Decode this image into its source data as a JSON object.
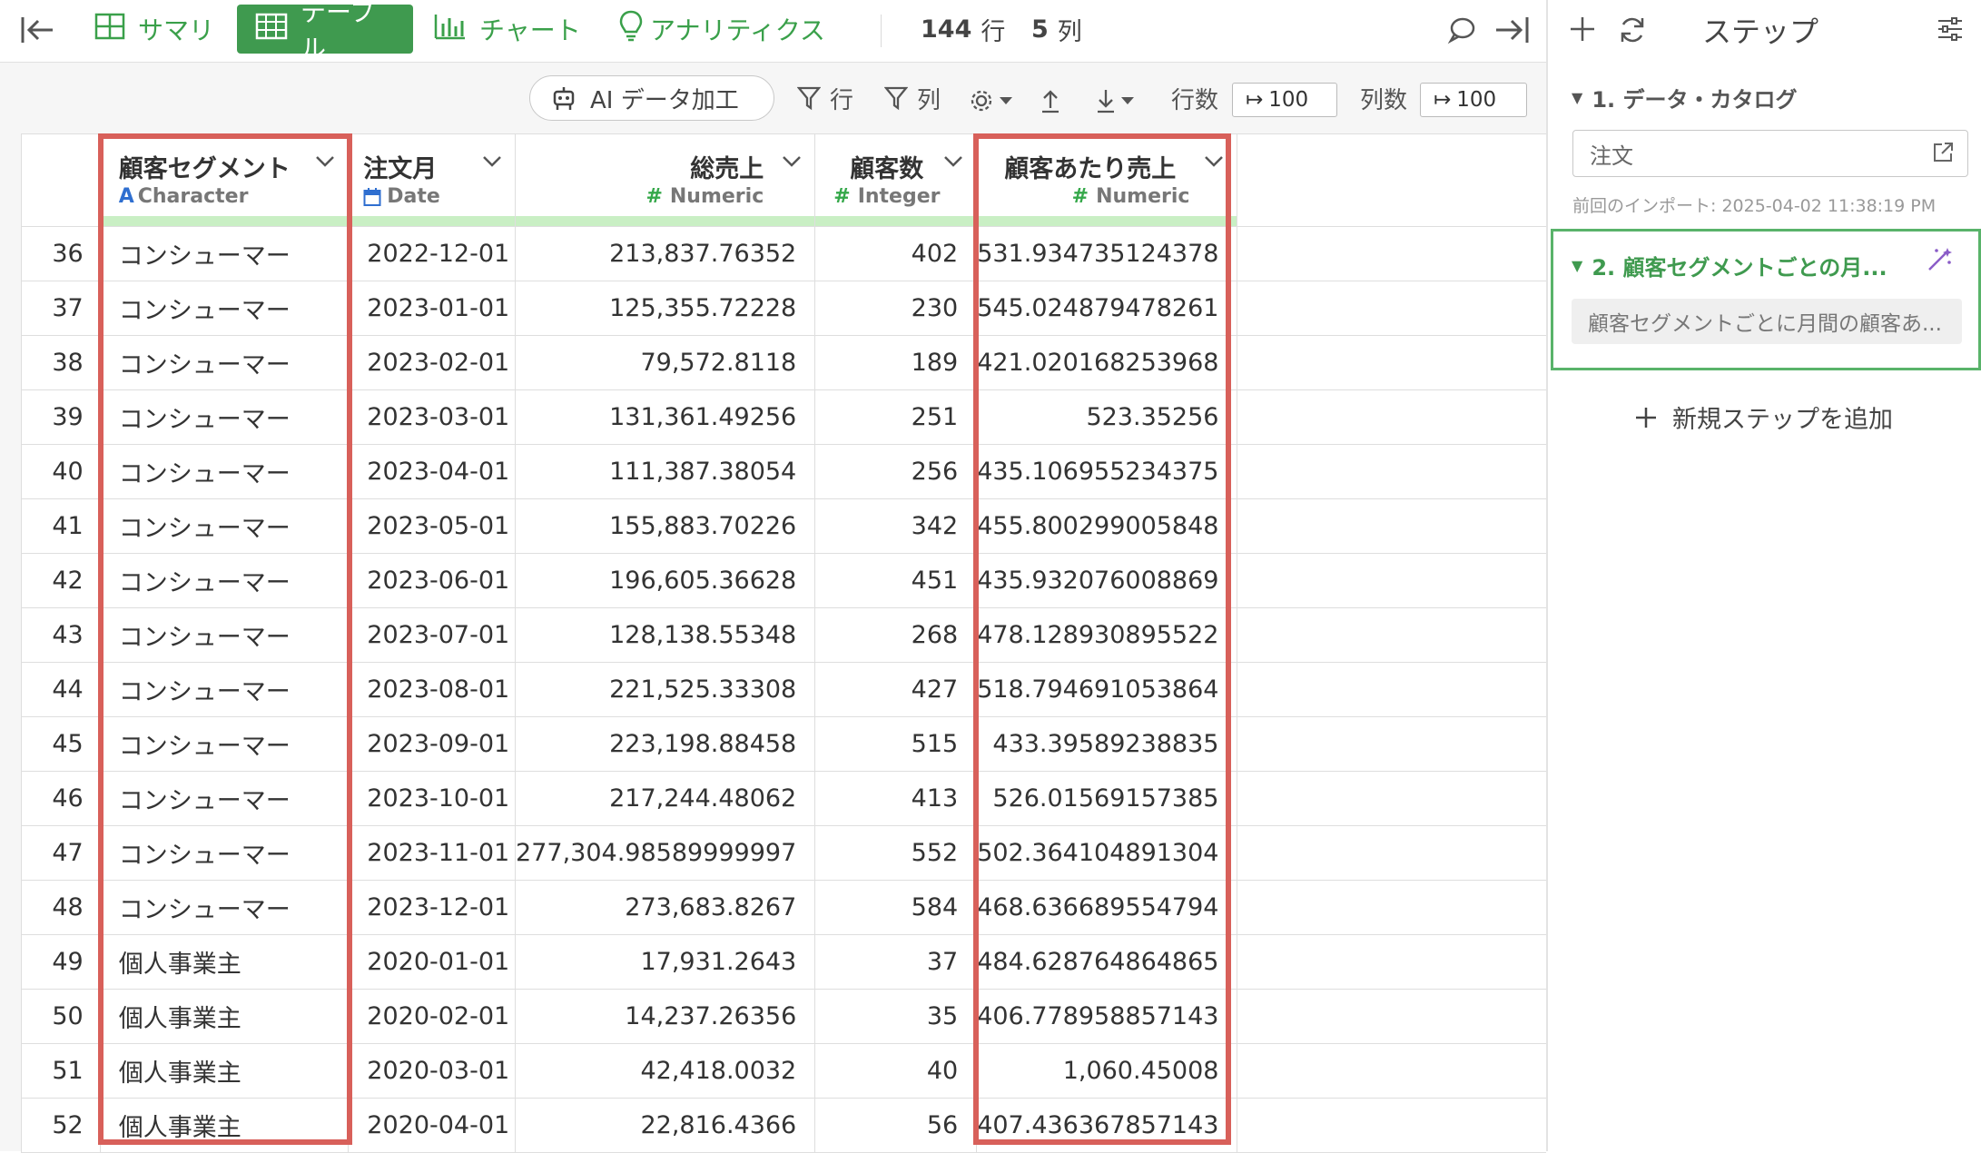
{
  "toolbar": {
    "tabs": [
      {
        "label": "サマリ",
        "icon": "grid-summary-icon"
      },
      {
        "label": "テーブル",
        "icon": "table-icon",
        "active": true
      },
      {
        "label": "チャート",
        "icon": "bar-chart-icon"
      },
      {
        "label": "アナリティクス",
        "icon": "lightbulb-icon"
      }
    ],
    "rows_count": "144",
    "rows_unit": "行",
    "cols_count": "5",
    "cols_unit": "列"
  },
  "subtoolbar": {
    "ai_button": "AI データ加工",
    "row_filter": "行",
    "col_filter": "列",
    "rows_label": "行数",
    "rows_value": "100",
    "cols_label": "列数",
    "cols_value": "100"
  },
  "table": {
    "columns": [
      {
        "name": "顧客セグメント",
        "type": "Character"
      },
      {
        "name": "注文月",
        "type": "Date"
      },
      {
        "name": "総売上",
        "type": "Numeric"
      },
      {
        "name": "顧客数",
        "type": "Integer"
      },
      {
        "name": "顧客あたり売上",
        "type": "Numeric"
      }
    ],
    "rows": [
      {
        "n": "36",
        "seg": "コンシューマー",
        "month": "2022-12-01",
        "sales": "213,837.76352",
        "cust": "402",
        "per": "531.934735124378"
      },
      {
        "n": "37",
        "seg": "コンシューマー",
        "month": "2023-01-01",
        "sales": "125,355.72228",
        "cust": "230",
        "per": "545.024879478261"
      },
      {
        "n": "38",
        "seg": "コンシューマー",
        "month": "2023-02-01",
        "sales": "79,572.8118",
        "cust": "189",
        "per": "421.020168253968"
      },
      {
        "n": "39",
        "seg": "コンシューマー",
        "month": "2023-03-01",
        "sales": "131,361.49256",
        "cust": "251",
        "per": "523.35256"
      },
      {
        "n": "40",
        "seg": "コンシューマー",
        "month": "2023-04-01",
        "sales": "111,387.38054",
        "cust": "256",
        "per": "435.106955234375"
      },
      {
        "n": "41",
        "seg": "コンシューマー",
        "month": "2023-05-01",
        "sales": "155,883.70226",
        "cust": "342",
        "per": "455.800299005848"
      },
      {
        "n": "42",
        "seg": "コンシューマー",
        "month": "2023-06-01",
        "sales": "196,605.36628",
        "cust": "451",
        "per": "435.932076008869"
      },
      {
        "n": "43",
        "seg": "コンシューマー",
        "month": "2023-07-01",
        "sales": "128,138.55348",
        "cust": "268",
        "per": "478.128930895522"
      },
      {
        "n": "44",
        "seg": "コンシューマー",
        "month": "2023-08-01",
        "sales": "221,525.33308",
        "cust": "427",
        "per": "518.794691053864"
      },
      {
        "n": "45",
        "seg": "コンシューマー",
        "month": "2023-09-01",
        "sales": "223,198.88458",
        "cust": "515",
        "per": "433.39589238835"
      },
      {
        "n": "46",
        "seg": "コンシューマー",
        "month": "2023-10-01",
        "sales": "217,244.48062",
        "cust": "413",
        "per": "526.01569157385"
      },
      {
        "n": "47",
        "seg": "コンシューマー",
        "month": "2023-11-01",
        "sales": "277,304.98589999997",
        "cust": "552",
        "per": "502.364104891304"
      },
      {
        "n": "48",
        "seg": "コンシューマー",
        "month": "2023-12-01",
        "sales": "273,683.8267",
        "cust": "584",
        "per": "468.636689554794"
      },
      {
        "n": "49",
        "seg": "個人事業主",
        "month": "2020-01-01",
        "sales": "17,931.2643",
        "cust": "37",
        "per": "484.628764864865"
      },
      {
        "n": "50",
        "seg": "個人事業主",
        "month": "2020-02-01",
        "sales": "14,237.26356",
        "cust": "35",
        "per": "406.778958857143"
      },
      {
        "n": "51",
        "seg": "個人事業主",
        "month": "2020-03-01",
        "sales": "42,418.0032",
        "cust": "40",
        "per": "1,060.45008"
      },
      {
        "n": "52",
        "seg": "個人事業主",
        "month": "2020-04-01",
        "sales": "22,816.4366",
        "cust": "56",
        "per": "407.436367857143"
      }
    ]
  },
  "panel": {
    "title": "ステップ",
    "step1_title": "1. データ・カタログ",
    "step1_source": "注文",
    "step1_meta": "前回のインポート: 2025-04-02 11:38:19 PM",
    "step2_title": "2. 顧客セグメントごとの月...",
    "step2_desc": "顧客セグメントごとに月間の顧客あ...",
    "add_step": "新規ステップを追加"
  },
  "colors": {
    "accent_green": "#3f9a4f",
    "highlight_red": "#d8605a",
    "header_bar": "#c9efc4"
  }
}
